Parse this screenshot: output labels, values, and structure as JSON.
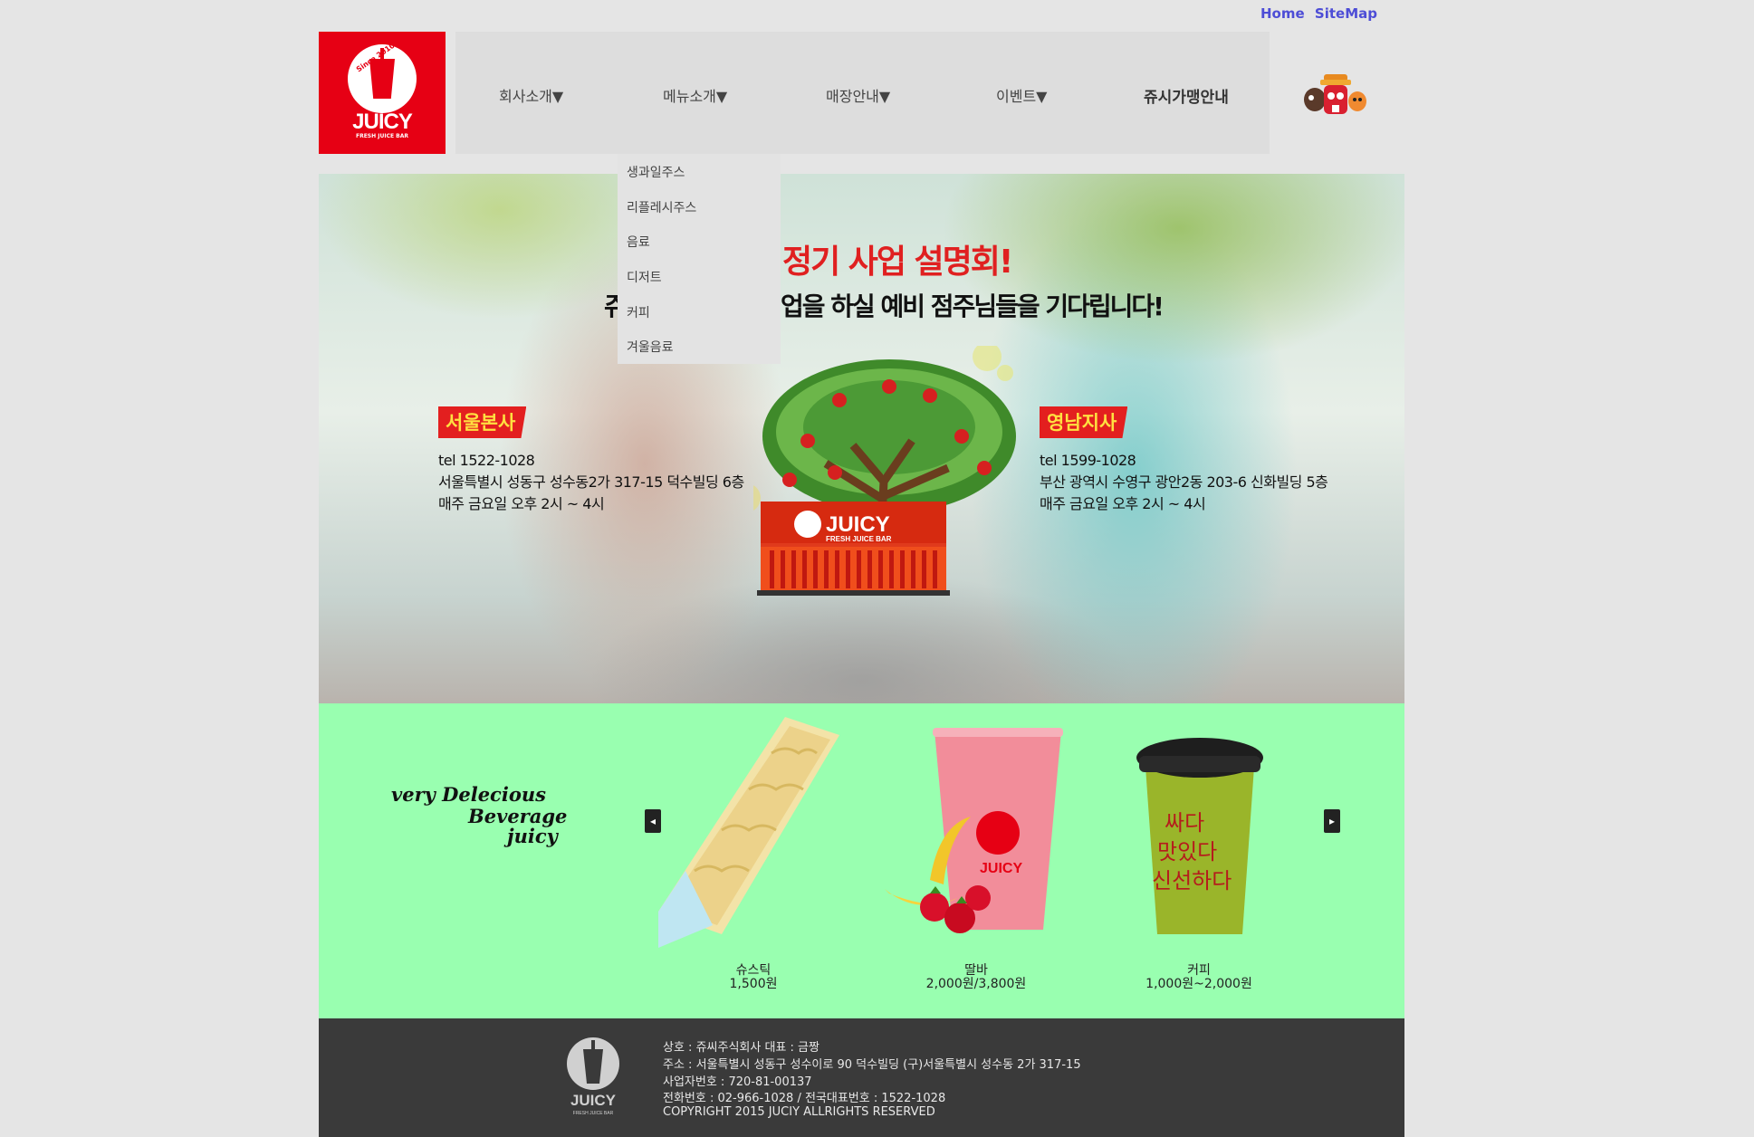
{
  "top_links": [
    "Home",
    "SiteMap"
  ],
  "logo": {
    "since": "Since 2010",
    "word": "JUICY",
    "sub": "FRESH JUICE BAR"
  },
  "nav": {
    "items": [
      "회사소개▼",
      "메뉴소개▼",
      "매장안내▼",
      "이벤트▼",
      "쥬시가맹안내"
    ]
  },
  "dropdown": {
    "items": [
      "생과일주스",
      "리플레시주스",
      "음료",
      "디저트",
      "커피",
      "겨울음료"
    ]
  },
  "hero": {
    "title": "정기 사업 설명회!",
    "subtitle_left": "쥬",
    "subtitle_right": "업을 하실 예비 점주님들을 기다립니다!",
    "store_sign": "JUICY",
    "store_sign_sub": "FRESH JUICE BAR",
    "left_office": {
      "badge": "서울본사",
      "tel": "tel 1522-1028",
      "address": "서울특별시 성동구 성수동2가 317-15 덕수빌딩 6층",
      "time": "매주 금요일 오후 2시 ~ 4시"
    },
    "right_office": {
      "badge": "영남지사",
      "tel": "tel 1599-1028",
      "address": "부산 광역시 수영구 광안2동 203-6 신화빌딩 5층",
      "time": "매주 금요일 오후 2시 ~ 4시"
    }
  },
  "products": {
    "script_lines": [
      "very Delecious",
      "Beverage",
      "juicy"
    ],
    "prev_arrow": "◂",
    "next_arrow": "▸",
    "cup_text": "JUICY",
    "coffee_text": [
      "싸다",
      "맛있다",
      "신선하다"
    ],
    "items": [
      {
        "name": "슈스틱",
        "price": "1,500원"
      },
      {
        "name": "딸바",
        "price": "2,000원/3,800원"
      },
      {
        "name": "커피",
        "price": "1,000원~2,000원"
      }
    ]
  },
  "footer": {
    "logo_word": "JUICY",
    "logo_sub": "FRESH JUICE BAR",
    "lines": [
      "상호 : 쥬씨주식회사 대표 : 금짱",
      "주소 : 서울특별시 성동구 성수이로 90 덕수빌딩 (구)서울특별시 성수동 2가 317-15",
      "사업자번호 : 720-81-00137",
      "전화번호 : 02-966-1028 / 전국대표번호 : 1522-1028",
      "COPYRIGHT 2015 JUCIY ALLRIGHTS RESERVED"
    ]
  },
  "colors": {
    "brand_red": "#e60014",
    "nav_bg": "#dddddd",
    "product_bg": "#99ffb0",
    "footer_bg": "#3a3a3a",
    "link_blue": "#4d4dd6"
  }
}
